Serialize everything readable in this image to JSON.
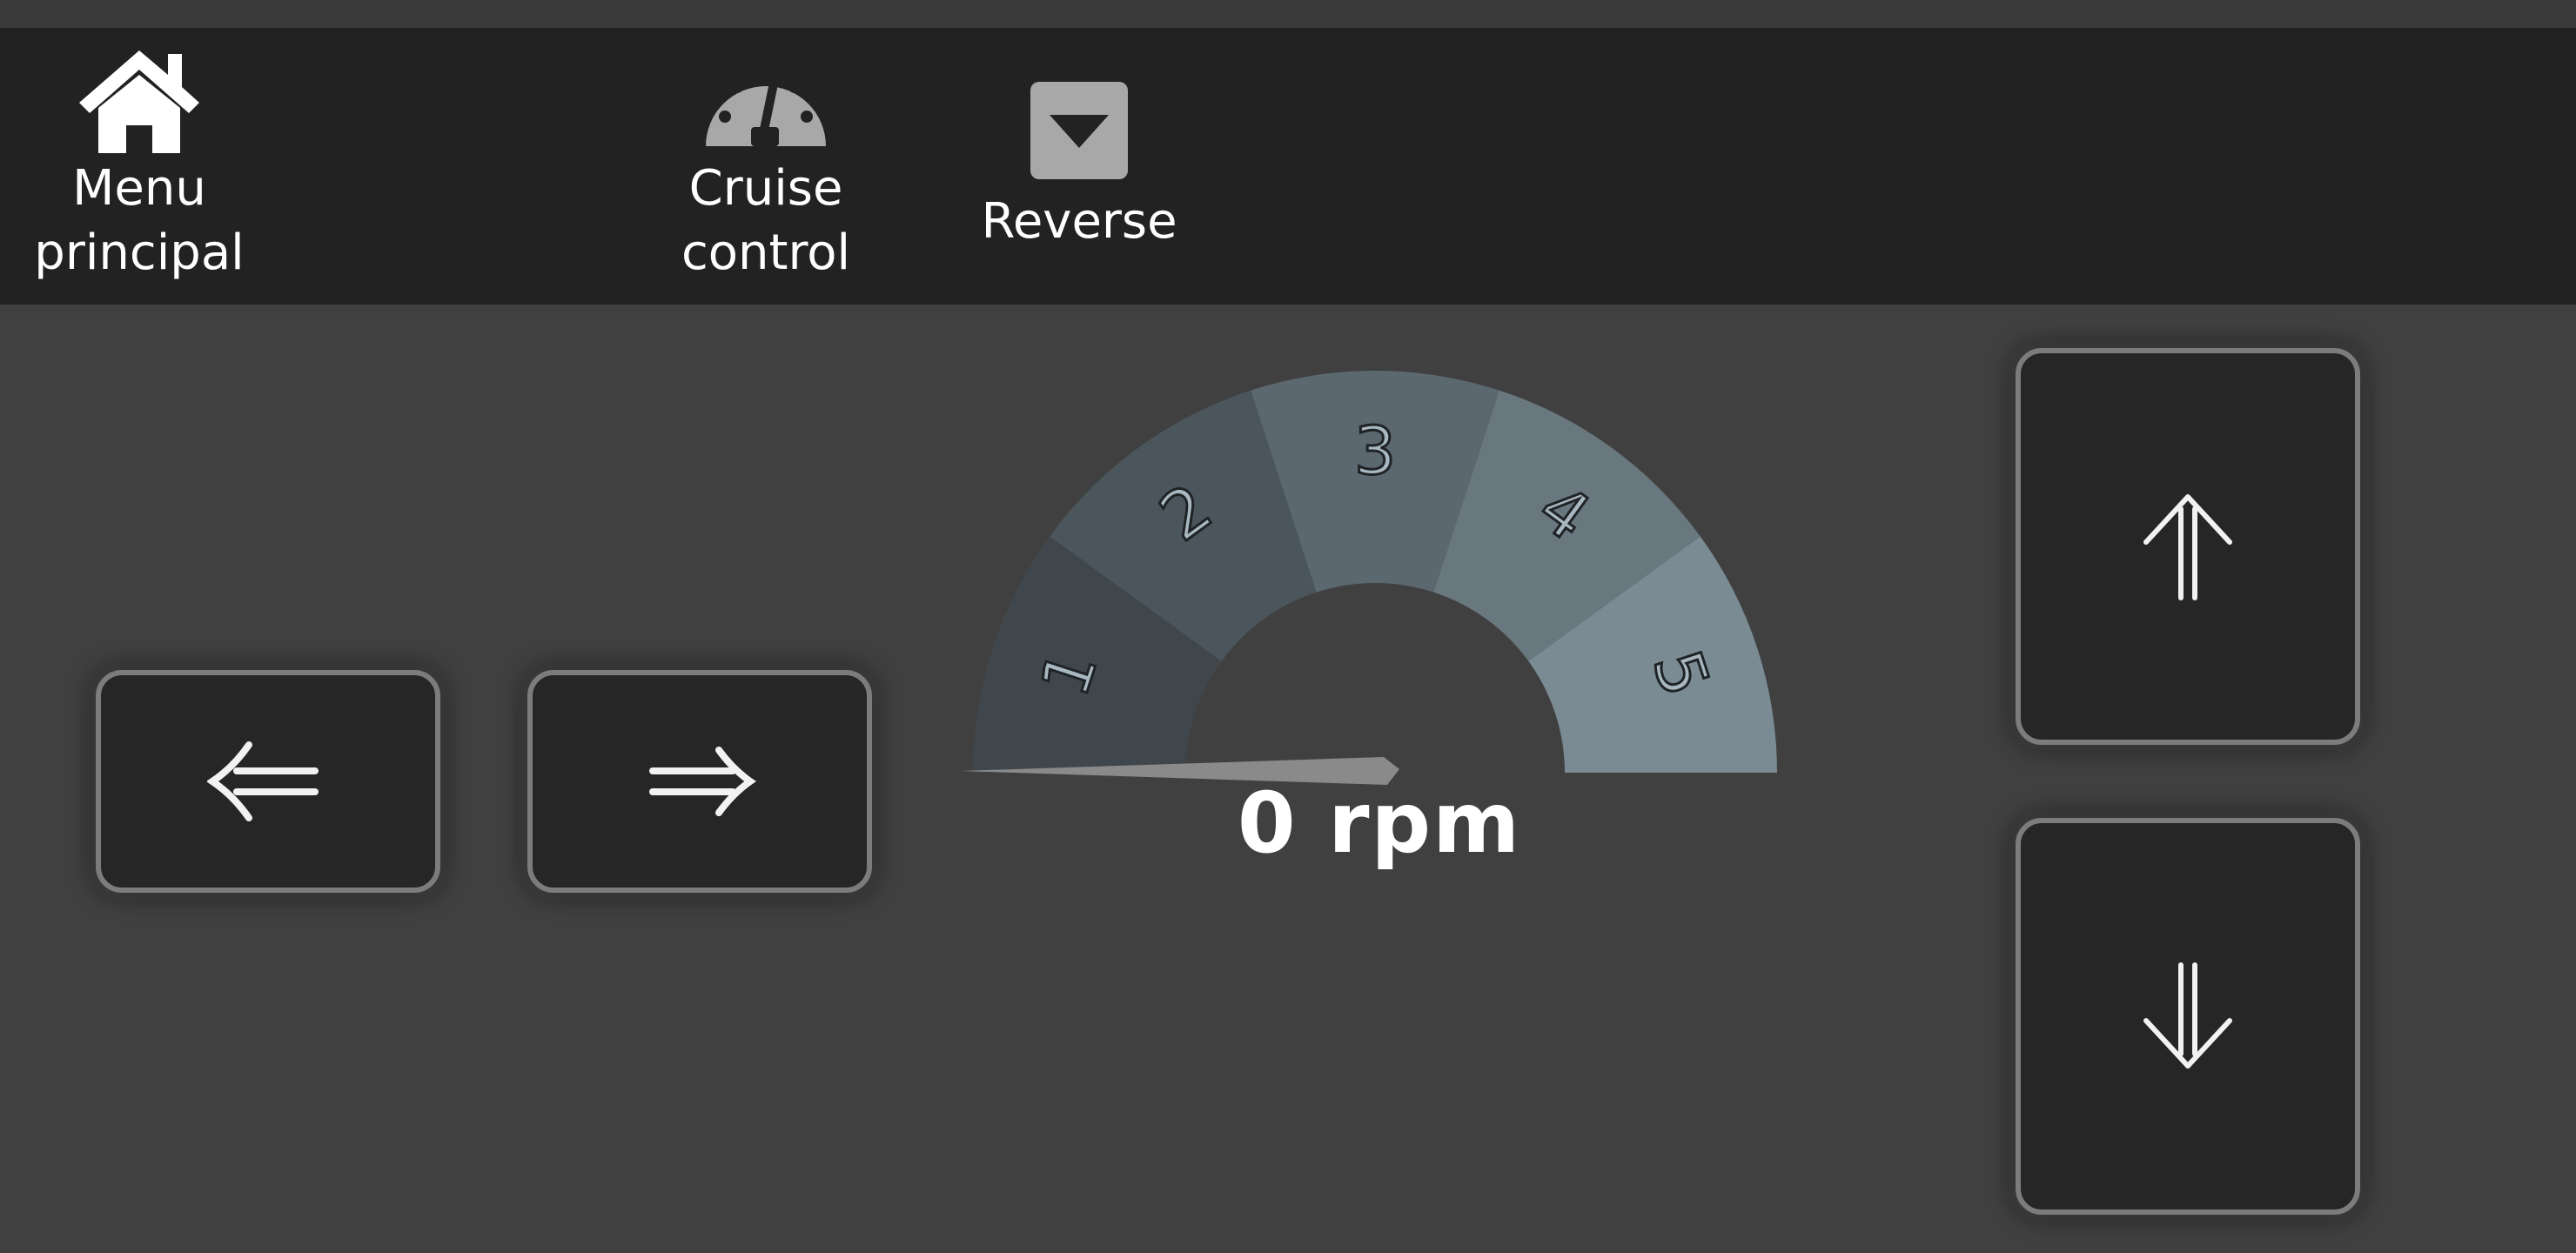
{
  "topbar": {
    "items": [
      {
        "label": "Menu\nprincipal",
        "icon": "home-icon"
      },
      {
        "label": "Cruise\ncontrol",
        "icon": "speedometer-icon"
      },
      {
        "label": "Reverse",
        "icon": "caret-down-icon"
      }
    ]
  },
  "controls": {
    "left_icon": "arrow-left-double-icon",
    "right_icon": "arrow-right-double-icon",
    "up_icon": "arrow-up-double-icon",
    "down_icon": "arrow-down-double-icon"
  },
  "gauge": {
    "segments": [
      "1",
      "2",
      "3",
      "4",
      "5"
    ],
    "segment_colors": [
      "#3f474d",
      "#4b565c",
      "#5b686f",
      "#69777e",
      "#7a8b94"
    ],
    "needle_color": "#8a8a8a",
    "rpm_value": 0,
    "rpm_text": "0 rpm"
  },
  "colors": {
    "background": "#404040",
    "topbar": "#222222",
    "button_fill": "#262626",
    "button_border": "#7c7c7c"
  }
}
